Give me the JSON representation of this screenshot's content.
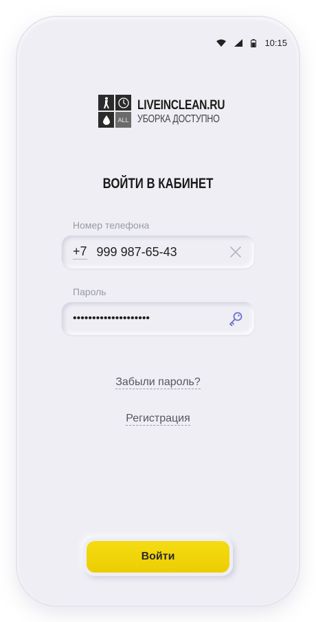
{
  "status_bar": {
    "time": "10:15",
    "icons": [
      "wifi-icon",
      "signal-icon",
      "battery-icon"
    ]
  },
  "logo": {
    "title": "LIVEINCLEAN.RU",
    "subtitle": "УБОРКА ДОСТУПНО",
    "mark_label": "ALL",
    "icons": [
      "person-icon",
      "clock-icon",
      "drop-icon"
    ]
  },
  "page_title": "ВОЙТИ В КАБИНЕТ",
  "phone_field": {
    "label": "Номер телефона",
    "prefix": "+7",
    "value": "999 987-65-43",
    "clear_icon": "close-icon"
  },
  "password_field": {
    "label": "Пароль",
    "value": "••••••••••••••••••••",
    "icon": "key-icon"
  },
  "links": {
    "forgot": "Забыли пароль?",
    "register": "Регистрация"
  },
  "login_button": "Войти",
  "colors": {
    "background": "#eeeef4",
    "accent_yellow": "#f0d308",
    "key_icon": "#6c6fd0"
  }
}
